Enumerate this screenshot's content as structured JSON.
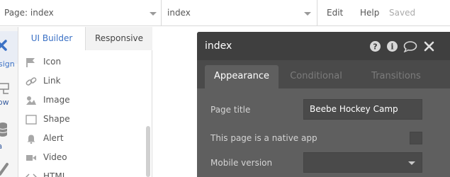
{
  "topbar": {
    "page_selector": "Page: index",
    "element_selector": "index",
    "menu": {
      "edit": "Edit",
      "help": "Help",
      "status": "Saved"
    }
  },
  "left_toolbar": {
    "items": [
      {
        "label": "sign",
        "icon": "design-cross-icon"
      },
      {
        "label": "flow",
        "icon": "workflow-icon"
      },
      {
        "label": "ta",
        "icon": "database-icon"
      },
      {
        "label": "",
        "icon": "pencil-icon"
      }
    ]
  },
  "panel": {
    "tabs": [
      {
        "label": "UI Builder",
        "active": true
      },
      {
        "label": "Responsive",
        "active": false
      }
    ],
    "elements": [
      {
        "label": "Icon",
        "icon": "flag-icon"
      },
      {
        "label": "Link",
        "icon": "link-icon"
      },
      {
        "label": "Image",
        "icon": "image-icon"
      },
      {
        "label": "Shape",
        "icon": "shape-icon"
      },
      {
        "label": "Alert",
        "icon": "bell-icon"
      },
      {
        "label": "Video",
        "icon": "video-icon"
      },
      {
        "label": "HTML",
        "icon": "code-icon"
      }
    ]
  },
  "dialog": {
    "title": "index",
    "header_icons": [
      "help-icon",
      "info-icon",
      "comment-icon",
      "close-icon"
    ],
    "tabs": [
      {
        "label": "Appearance",
        "active": true
      },
      {
        "label": "Conditional",
        "active": false
      },
      {
        "label": "Transitions",
        "active": false
      }
    ],
    "fields": {
      "page_title_label": "Page title",
      "page_title_value": "Beebe Hockey Camp",
      "native_app_label": "This page is a native app",
      "native_app_checked": false,
      "mobile_version_label": "Mobile version",
      "mobile_version_value": ""
    }
  },
  "colors": {
    "accent": "#3b71c5",
    "dialog_body": "#5f5f5f",
    "dialog_header": "#3f3f3f"
  }
}
